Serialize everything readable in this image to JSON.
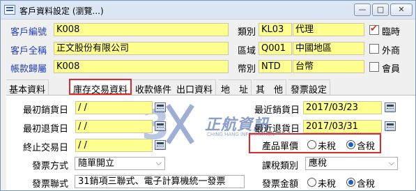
{
  "window": {
    "title": "客戶資料設定 (瀏覽...)",
    "minimize_label": "—",
    "maximize_label": "□",
    "close_label": "✕"
  },
  "header": {
    "customer_code_label": "客戶編號",
    "customer_code_value": "K008",
    "customer_name_label": "客戶全稱",
    "customer_name_value": "正文股份有限公司",
    "account_label": "帳款歸屬",
    "account_value": "K008",
    "category_label": "類別",
    "category_code": "KL03",
    "category_name": "代理",
    "region_label": "區域",
    "region_code": "Q001",
    "region_name": "中國地區",
    "currency_label": "幣別",
    "currency_code": "NTD",
    "currency_name": "台幣",
    "temporary_label": "臨時",
    "temporary_checked": true,
    "foreign_label": "外商",
    "foreign_checked": false,
    "member_label": "會員",
    "member_checked": false
  },
  "tabs": [
    {
      "label": "基本資料",
      "active": false
    },
    {
      "label": "庫存交易資料",
      "active": true
    },
    {
      "label": "收款條件",
      "active": false
    },
    {
      "label": "出口資料",
      "active": false
    },
    {
      "label": "地　址",
      "active": false
    },
    {
      "label": "其　他",
      "active": false
    },
    {
      "label": "發票設定",
      "active": false
    }
  ],
  "inventory": {
    "first_sale_label": "最初銷貨日",
    "first_sale_value": "/ /",
    "first_return_label": "最初退貨日",
    "first_return_value": "/ /",
    "end_trade_label": "終止交易日",
    "end_trade_value": "/ /",
    "last_sale_label": "最近銷貨日",
    "last_sale_value": "2017/03/23",
    "last_return_label": "最近退貨日",
    "last_return_value": "2017/03/31",
    "price_label": "產品單價",
    "price_untaxed": "未稅",
    "price_taxed": "含稅",
    "price_selected": "含稅",
    "invoice_method_label": "發票方式",
    "invoice_method_value": "隨單開立",
    "invoice_copy_label": "發票聯式",
    "invoice_copy_value": "31銷項三聯式、電子計算機統一發票",
    "tax_category_label": "課稅類別",
    "tax_category_value": "應稅",
    "invoice_amount_label": "發票金額",
    "invoice_amount_untaxed": "未稅",
    "invoice_amount_taxed": "含稅"
  },
  "watermark": {
    "title": "正航資訊",
    "subtitle": "CHING HANG INFORMATION"
  },
  "colors": {
    "field_bg": "#ffff8f",
    "label_blue": "#1f3fbf",
    "highlight_red": "#e32626"
  }
}
